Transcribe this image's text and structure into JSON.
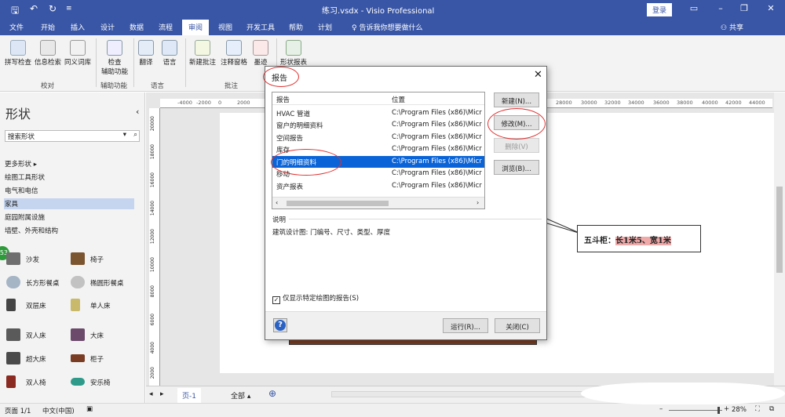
{
  "window": {
    "title": "练习.vsdx  -  Visio Professional",
    "login": "登录"
  },
  "menu": {
    "items": [
      "文件",
      "开始",
      "插入",
      "设计",
      "数据",
      "流程",
      "审阅",
      "视图",
      "开发工具",
      "帮助",
      "计划"
    ],
    "active": "审阅",
    "tell_me": "告诉我你想要做什么",
    "share": "共享"
  },
  "ribbon": {
    "proofing": {
      "buttons": [
        "拼写检查",
        "信息检索",
        "同义词库"
      ],
      "label": "校对"
    },
    "accessibility": {
      "button_line1": "检查",
      "button_line2": "辅助功能",
      "label": "辅助功能"
    },
    "language": {
      "buttons": [
        "翻译",
        "语言"
      ],
      "label": "语言"
    },
    "comments": {
      "buttons": [
        "新建批注",
        "注释窗格",
        "墨迹"
      ],
      "label": "批注"
    },
    "shape_report": "形状报表"
  },
  "shapes_panel": {
    "title": "形状",
    "search_placeholder": "搜索形状",
    "stencils": [
      "更多形状",
      "绘图工具形状",
      "电气和电信",
      "家具",
      "庭园附属设施",
      "墙壁、外壳和结构"
    ],
    "selected_stencil": "家具",
    "items": [
      [
        "沙发",
        "椅子"
      ],
      [
        "长方形餐桌",
        "椭圆形餐桌"
      ],
      [
        "双层床",
        "单人床"
      ],
      [
        "双人床",
        "大床"
      ],
      [
        "超大床",
        "柜子"
      ],
      [
        "双人椅",
        "安乐椅"
      ]
    ],
    "badge": "53"
  },
  "ruler": {
    "top_ticks": [
      "-4000",
      "-2000",
      "0",
      "2000",
      "28000",
      "30000",
      "32000",
      "34000",
      "36000",
      "38000",
      "40000",
      "42000",
      "44000"
    ],
    "left_ticks": [
      "20000",
      "18000",
      "16000",
      "14000",
      "12000",
      "10000",
      "8000",
      "6000",
      "4000",
      "2000"
    ]
  },
  "callout": {
    "prefix": "五斗柜：",
    "highlight": "长1米5、宽1米"
  },
  "sheets": {
    "page_tab": "页-1",
    "all": "全部"
  },
  "status": {
    "page": "页面 1/1",
    "lang": "中文(中国)",
    "zoom": "28%"
  },
  "dialog": {
    "title": "报告",
    "columns": [
      "报告",
      "位置"
    ],
    "rows": [
      {
        "name": "HVAC 管道",
        "loc": "C:\\Program Files (x86)\\Micr"
      },
      {
        "name": "窗户的明细资料",
        "loc": "C:\\Program Files (x86)\\Micr"
      },
      {
        "name": "空间报告",
        "loc": "C:\\Program Files (x86)\\Micr"
      },
      {
        "name": "库存",
        "loc": "C:\\Program Files (x86)\\Micr"
      },
      {
        "name": "门的明细资料",
        "loc": "C:\\Program Files (x86)\\Micr"
      },
      {
        "name": "移动",
        "loc": "C:\\Program Files (x86)\\Micr"
      },
      {
        "name": "资产报表",
        "loc": "C:\\Program Files (x86)\\Micr"
      }
    ],
    "selected_index": 4,
    "buttons": {
      "new": "新建(N)...",
      "modify": "修改(M)...",
      "delete": "删除(V)",
      "browse": "浏览(B)..."
    },
    "desc_label": "说明",
    "description": "建筑设计图: 门编号、尺寸、类型、厚度",
    "checkbox": "仅显示特定绘图的报告(S)",
    "run": "运行(R)...",
    "close": "关闭(C)"
  },
  "colors": {
    "accent": "#3956a6",
    "selection": "#0a64d8",
    "annotation": "#e03030"
  }
}
